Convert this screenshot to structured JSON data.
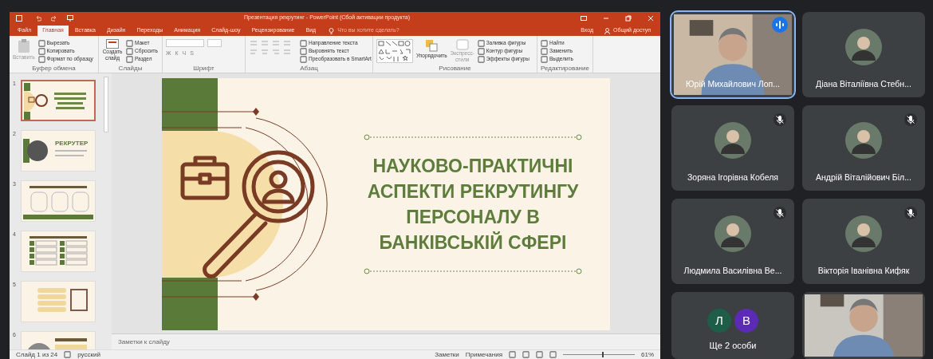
{
  "window": {
    "title": "Презентация рекрутинг - PowerPoint (Сбой активации продукта)"
  },
  "tabs": [
    {
      "label": "Файл",
      "selected": false
    },
    {
      "label": "Главная",
      "selected": true
    },
    {
      "label": "Вставка",
      "selected": false
    },
    {
      "label": "Дизайн",
      "selected": false
    },
    {
      "label": "Переходы",
      "selected": false
    },
    {
      "label": "Анимация",
      "selected": false
    },
    {
      "label": "Слайд-шоу",
      "selected": false
    },
    {
      "label": "Рецензирование",
      "selected": false
    },
    {
      "label": "Вид",
      "selected": false
    }
  ],
  "tell_me": {
    "placeholder": "Что вы хотите сделать?"
  },
  "account": {
    "sign_in": "Вход",
    "share": "Общий доступ"
  },
  "ribbon": {
    "clipboard": {
      "label": "Буфер обмена",
      "paste": "Вставить",
      "items": [
        "Вырезать",
        "Копировать",
        "Формат по образцу"
      ]
    },
    "slides": {
      "label": "Слайды",
      "new_slide": "Создать слайд",
      "items": [
        "Макет",
        "Сбросить",
        "Раздел"
      ]
    },
    "font": {
      "label": "Шрифт",
      "format_buttons": [
        "Ж",
        "К",
        "Ч",
        "S"
      ]
    },
    "paragraph": {
      "label": "Абзац",
      "items": [
        "Направление текста",
        "Выровнять текст",
        "Преобразовать в SmartArt"
      ]
    },
    "drawing": {
      "label": "Рисование",
      "arrange": "Упорядочить",
      "quick_styles": "Экспресс-стили",
      "items": [
        "Заливка фигуры",
        "Контур фигуры",
        "Эффекты фигуры"
      ]
    },
    "editing": {
      "label": "Редактирование",
      "items": [
        "Найти",
        "Заменить",
        "Выделить"
      ]
    }
  },
  "slides": [
    {
      "number": "1",
      "selected": true
    },
    {
      "number": "2",
      "selected": false,
      "title": "РЕКРУТЕР"
    },
    {
      "number": "3",
      "selected": false
    },
    {
      "number": "4",
      "selected": false
    },
    {
      "number": "5",
      "selected": false
    },
    {
      "number": "6",
      "selected": false
    }
  ],
  "current_slide": {
    "title_lines": [
      "НАУКОВО-ПРАКТИЧНІ",
      "АСПЕКТИ РЕКРУТИНГУ",
      "ПЕРСОНАЛУ В",
      "БАНКІВСЬКІЙ СФЕРІ"
    ]
  },
  "notes": {
    "placeholder": "Заметки к слайду"
  },
  "status_bar": {
    "slide_count": "Слайд 1 из 24",
    "language": "русский",
    "notes": "Заметки",
    "comments": "Примечания",
    "zoom": "61%",
    "level": 0.55
  },
  "participants": [
    {
      "kind": "video",
      "name": "Юрій Михайлович Лоп...",
      "speaking": true,
      "muted": false
    },
    {
      "kind": "avatar",
      "name": "Діана Віталіївна Стебн...",
      "speaking": false,
      "muted": false
    },
    {
      "kind": "avatar",
      "name": "Зоряна Ігорівна Кобеля",
      "speaking": false,
      "muted": true
    },
    {
      "kind": "avatar",
      "name": "Андрій Віталійович Біл...",
      "speaking": false,
      "muted": true
    },
    {
      "kind": "avatar",
      "name": "Людмила Василівна Ве...",
      "speaking": false,
      "muted": true
    },
    {
      "kind": "avatar",
      "name": "Вікторія Іванівна Кифяк",
      "speaking": false,
      "muted": true
    },
    {
      "kind": "overflow",
      "label": "Ще 2 особи",
      "initials": [
        {
          "letter": "Л",
          "color": "#1e5d47"
        },
        {
          "letter": "В",
          "color": "#5b2bb5"
        }
      ]
    },
    {
      "kind": "video",
      "speaking": false,
      "muted": false
    }
  ]
}
